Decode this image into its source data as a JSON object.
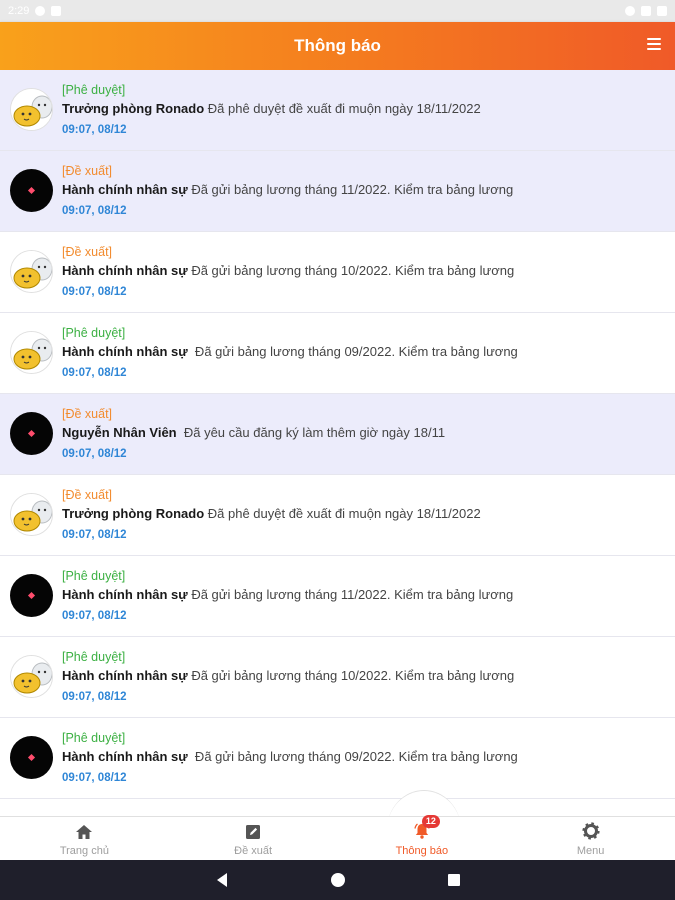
{
  "status_bar": {
    "time": "2:29"
  },
  "header": {
    "title": "Thông báo",
    "menu_icon": "hamburger-icon"
  },
  "colors": {
    "accent": "#f05a28",
    "approve": "#3cb043",
    "propose": "#f28b2e",
    "time": "#2f86d6",
    "unread_bg": "#ececfb"
  },
  "notifications": [
    {
      "tag": "[Phê duyệt]",
      "tag_type": "approve",
      "sender": "Trưởng phòng Ronado",
      "message": " Đã phê duyệt đề xuất đi muộn ngày 18/11/2022",
      "time": "09:07, 08/12",
      "unread": true,
      "avatar": "cat"
    },
    {
      "tag": "[Đề xuất]",
      "tag_type": "propose",
      "sender": "Hành chính nhân sự",
      "message": " Đã gửi bảng lương tháng 11/2022. Kiểm tra bảng lương",
      "time": "09:07, 08/12",
      "unread": true,
      "avatar": "dark"
    },
    {
      "tag": "[Đề xuất]",
      "tag_type": "propose",
      "sender": "Hành chính nhân sự",
      "message": " Đã gửi bảng lương tháng 10/2022. Kiểm tra bảng lương",
      "time": "09:07, 08/12",
      "unread": false,
      "avatar": "cat"
    },
    {
      "tag": "[Phê duyệt]",
      "tag_type": "approve",
      "sender": "Hành chính nhân sự",
      "message": "  Đã gửi bảng lương tháng 09/2022. Kiểm tra bảng lương",
      "time": "09:07, 08/12",
      "unread": false,
      "avatar": "cat"
    },
    {
      "tag": "[Đề xuất]",
      "tag_type": "propose",
      "sender": "Nguyễn Nhân Viên",
      "message": "  Đã yêu cầu đăng ký làm thêm giờ ngày 18/11",
      "time": "09:07, 08/12",
      "unread": true,
      "avatar": "dark"
    },
    {
      "tag": "[Đề xuất]",
      "tag_type": "propose",
      "sender": "Trưởng phòng Ronado",
      "message": " Đã phê duyệt đề xuất đi muộn ngày 18/11/2022",
      "time": "09:07, 08/12",
      "unread": false,
      "avatar": "cat"
    },
    {
      "tag": "[Phê duyệt]",
      "tag_type": "approve",
      "sender": "Hành chính nhân sự",
      "message": " Đã gửi bảng lương tháng 11/2022. Kiểm tra bảng lương",
      "time": "09:07, 08/12",
      "unread": false,
      "avatar": "dark"
    },
    {
      "tag": "[Phê duyệt]",
      "tag_type": "approve",
      "sender": "Hành chính nhân sự",
      "message": " Đã gửi bảng lương tháng 10/2022. Kiểm tra bảng lương",
      "time": "09:07, 08/12",
      "unread": false,
      "avatar": "cat"
    },
    {
      "tag": "[Phê duyệt]",
      "tag_type": "approve",
      "sender": "Hành chính nhân sự",
      "message": "  Đã gửi bảng lương tháng 09/2022. Kiểm tra bảng lương",
      "time": "09:07, 08/12",
      "unread": false,
      "avatar": "dark"
    }
  ],
  "bottom_nav": {
    "tabs": [
      {
        "label": "Trang chủ",
        "icon": "home-icon",
        "active": false
      },
      {
        "label": "Đề xuất",
        "icon": "edit-icon",
        "active": false
      },
      {
        "label": "Thông báo",
        "icon": "bell-icon",
        "active": true,
        "badge": "12"
      },
      {
        "label": "Menu",
        "icon": "gear-icon",
        "active": false
      }
    ]
  },
  "system_nav": {
    "back": "back-icon",
    "home": "home-circle-icon",
    "recents": "recents-icon"
  }
}
